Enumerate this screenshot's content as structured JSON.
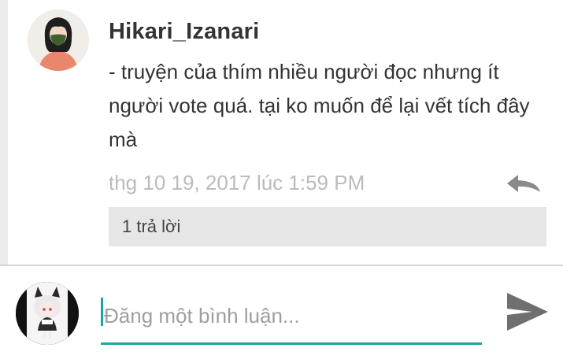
{
  "comment": {
    "author": "Hikari_Izanari",
    "text": "- truyện của thím nhiều người đọc nhưng ít người vote quá. tại ko muốn để lại vết tích đây mà",
    "timestamp": "thg 10 19, 2017 lúc 1:59 PM",
    "reply_count_label": "1 trả lời",
    "reply_icon": "reply-arrow-icon"
  },
  "compose": {
    "placeholder": "Đăng một bình luận...",
    "value": "",
    "send_icon": "send-icon"
  },
  "colors": {
    "accent": "#1aa7a1",
    "timestamp": "#bbbbbb",
    "reply_bar": "#e6e6e6",
    "icon_gray": "#6f6f6f"
  }
}
